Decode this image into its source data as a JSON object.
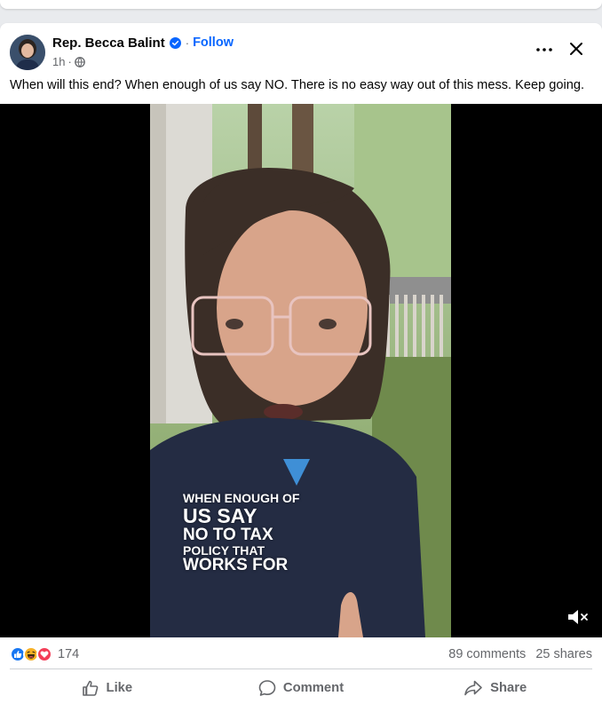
{
  "post": {
    "author": "Rep. Becca Balint",
    "separator": "·",
    "follow_label": "Follow",
    "time": "1h",
    "time_separator": "·",
    "audience_icon": "globe-icon",
    "text": "When will this end? When enough of us say NO. There is no easy way out of this mess. Keep going."
  },
  "video": {
    "caption_lines": [
      "WHEN ENOUGH OF",
      "US SAY",
      "NO TO TAX",
      "POLICY THAT",
      "WORKS FOR"
    ],
    "mute_icon": "speaker-muted-icon"
  },
  "stats": {
    "reaction_icons": [
      "like-icon",
      "haha-icon",
      "love-icon"
    ],
    "reaction_count": "174",
    "comments": "89 comments",
    "shares": "25 shares"
  },
  "actions": {
    "like": "Like",
    "comment": "Comment",
    "share": "Share"
  },
  "colors": {
    "link_blue": "#0866ff",
    "secondary_text": "#65676b",
    "like_blue": "#1877f2",
    "love_red": "#f33e58",
    "haha_yellow": "#f7b125"
  }
}
